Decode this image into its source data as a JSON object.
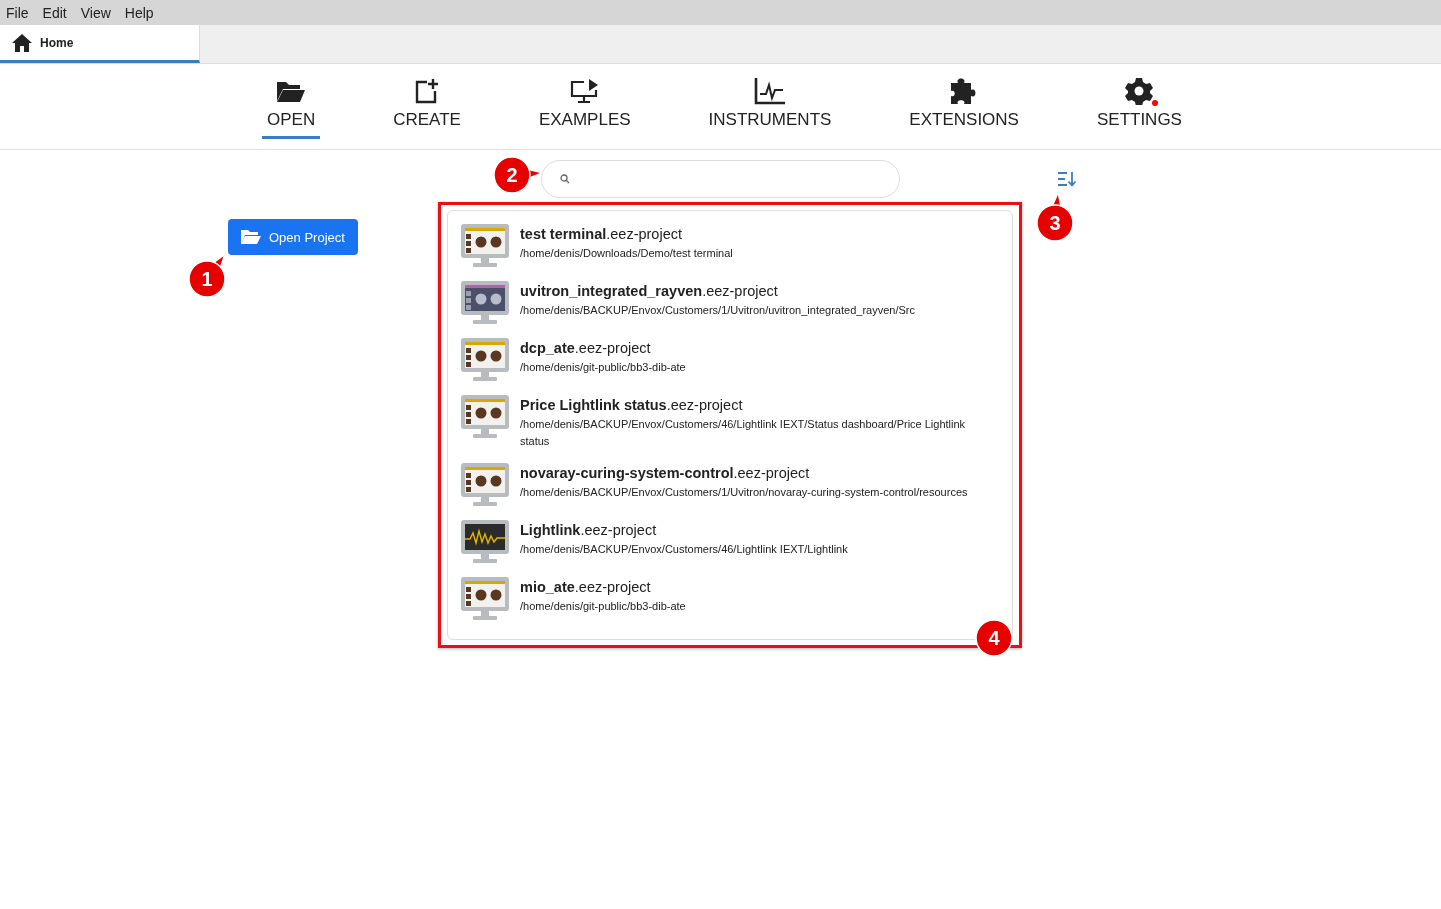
{
  "menu": [
    "File",
    "Edit",
    "View",
    "Help"
  ],
  "tabs": [
    {
      "label": "Home",
      "selected": true
    }
  ],
  "nav": [
    {
      "kind": "open",
      "label": "OPEN",
      "selected": true,
      "badge": false
    },
    {
      "kind": "create",
      "label": "CREATE",
      "selected": false,
      "badge": false
    },
    {
      "kind": "examples",
      "label": "EXAMPLES",
      "selected": false,
      "badge": false
    },
    {
      "kind": "instruments",
      "label": "INSTRUMENTS",
      "selected": false,
      "badge": false
    },
    {
      "kind": "extensions",
      "label": "EXTENSIONS",
      "selected": false,
      "badge": false
    },
    {
      "kind": "settings",
      "label": "SETTINGS",
      "selected": false,
      "badge": true
    }
  ],
  "open_button": {
    "label": "Open Project"
  },
  "projects": [
    {
      "kind": "dashboard",
      "name": "**test terminal**.eez-project",
      "path": "/home/denis/Downloads/Demo/test terminal"
    },
    {
      "kind": "display",
      "name": "**uvitron_integrated_rayven**.eez-project",
      "path": "/home/denis/BACKUP/Envox/Customers/1/Uvitron/uvitron_integrated_rayven/Src"
    },
    {
      "kind": "dashboard",
      "name": "**dcp_ate**.eez-project",
      "path": "/home/denis/git-public/bb3-dib-ate"
    },
    {
      "kind": "dashboard",
      "name": "**Price Lightlink status**.eez-project",
      "path": "/home/denis/BACKUP/Envox/Customers/46/Lightlink IEXT/Status dashboard/Price Lightlink status"
    },
    {
      "kind": "dashboard",
      "name": "**novaray-curing-system-control**.eez-project",
      "path": "/home/denis/BACKUP/Envox/Customers/1/Uvitron/novaray-curing-system-control/resources"
    },
    {
      "kind": "scope",
      "name": "**Lightlink**.eez-project",
      "path": "/home/denis/BACKUP/Envox/Customers/46/Lightlink IEXT/Lightlink"
    },
    {
      "kind": "dashboard",
      "name": "**mio_ate**.eez-project",
      "path": "/home/denis/git-public/bb3-dib-ate"
    }
  ],
  "annotations": [
    {
      "label": "1",
      "kind": "upright"
    },
    {
      "label": "2",
      "kind": "right"
    },
    {
      "label": "3",
      "kind": "up"
    },
    {
      "label": "4",
      "kind": "plain"
    }
  ]
}
